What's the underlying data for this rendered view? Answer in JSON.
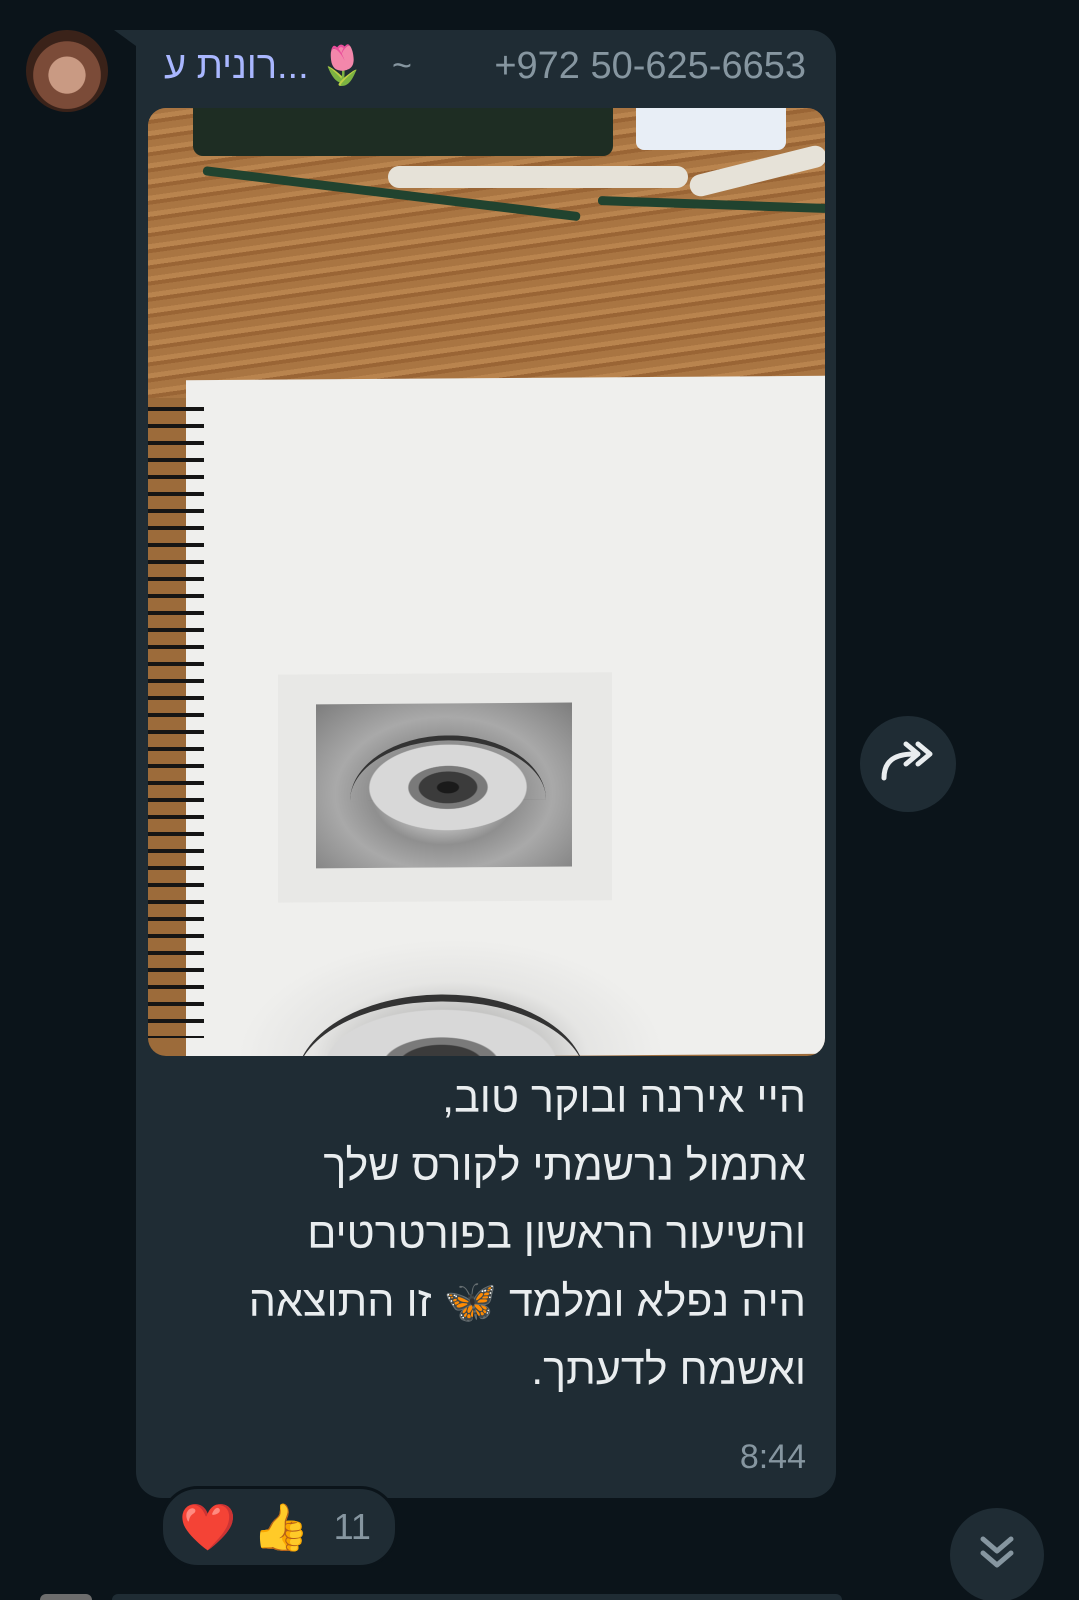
{
  "message": {
    "sender_name": "רונית ע...",
    "sender_name_emoji": "🌷",
    "sender_tilde": "~",
    "sender_phone": "+972 50-625-6653",
    "text": "היי אירנה ובוקר טוב,\nאתמול נרשמתי לקורס שלך\nוהשיעור הראשון בפורטרטים\nהיה נפלא ומלמד 🦋 זו התוצאה\nואשמח לדעתך.",
    "time": "8:44"
  },
  "reactions": {
    "emojis": [
      "❤️",
      "👍"
    ],
    "count": "11"
  },
  "icons": {
    "forward": "forward-icon",
    "scroll_down": "double-chevron-down-icon"
  },
  "colors": {
    "background": "#0b141a",
    "bubble": "#1f2c34",
    "sender_name": "#a9b7ff",
    "meta_text": "#8696a0",
    "message_text": "#e9edef"
  }
}
